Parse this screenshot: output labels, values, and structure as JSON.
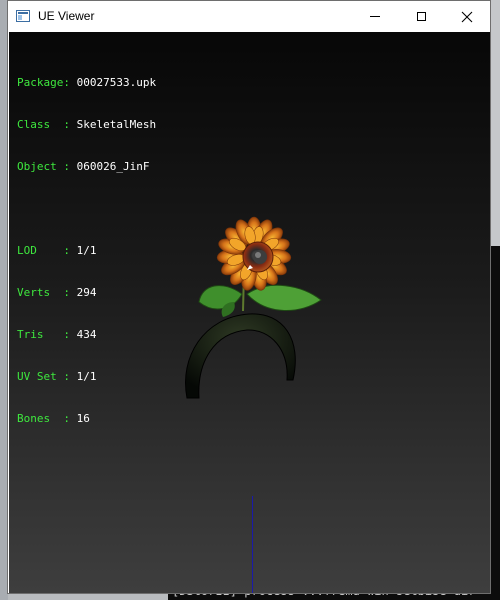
{
  "window": {
    "title": "UE Viewer",
    "controls": {
      "minimize": "minimize",
      "maximize": "maximize",
      "close": "close"
    }
  },
  "info": {
    "package": {
      "label": "Package",
      "value": "00027533.upk"
    },
    "class": {
      "label": "Class  ",
      "value": "SkeletalMesh"
    },
    "object": {
      "label": "Object ",
      "value": "060026_JinF"
    },
    "lod": {
      "label": "LOD    ",
      "value": "1/1"
    },
    "verts": {
      "label": "Verts  ",
      "value": "294"
    },
    "tris": {
      "label": "Tris   ",
      "value": "434"
    },
    "uvset": {
      "label": "UV Set ",
      "value": "1/1"
    },
    "bones": {
      "label": "Bones  ",
      "value": "16"
    }
  },
  "background": {
    "console_tail": "[DStorII] process  ...fremd wih setbise  dir"
  },
  "colors": {
    "label_green": "#3ee83e",
    "value_white": "#ffffff",
    "axis_blue": "#1a1aa8"
  }
}
